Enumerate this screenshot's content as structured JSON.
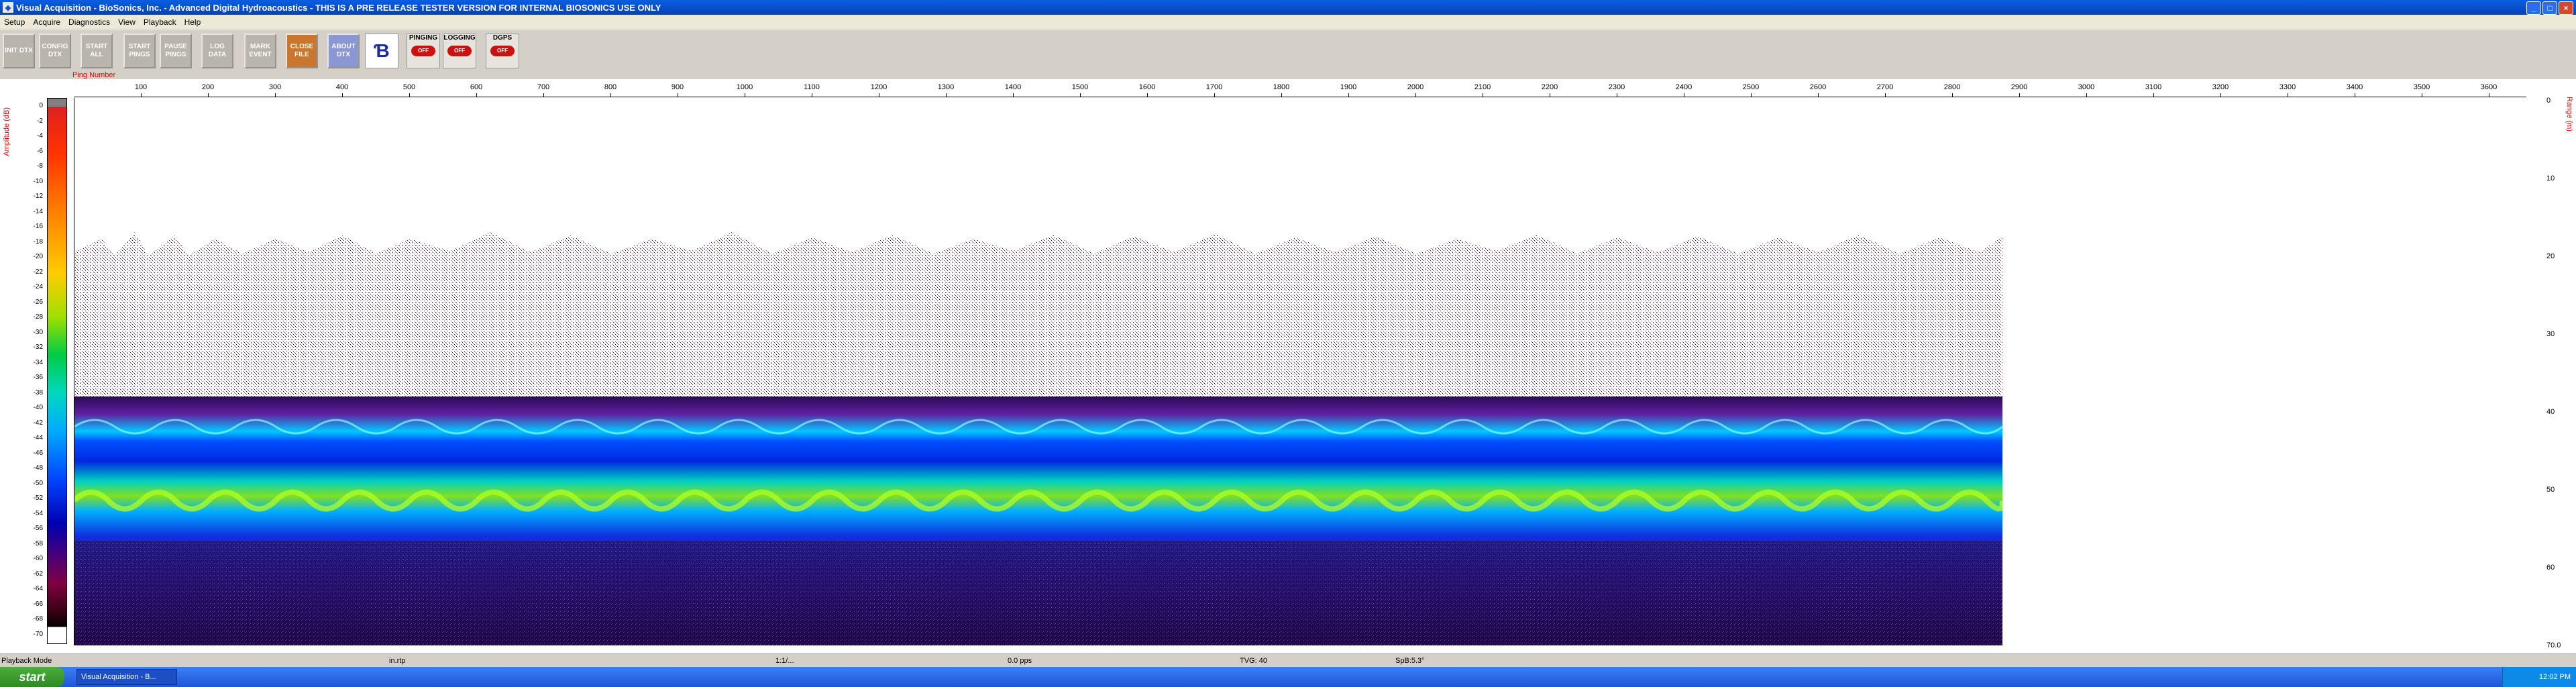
{
  "window": {
    "title": "Visual Acquisition  -  BioSonics, Inc.  -  Advanced Digital Hydroacoustics  -  THIS IS A PRE RELEASE TESTER VERSION FOR INTERNAL BIOSONICS USE ONLY",
    "controls": [
      "_",
      "□",
      "×"
    ]
  },
  "menu": [
    "Setup",
    "Acquire",
    "Diagnostics",
    "View",
    "Playback",
    "Help"
  ],
  "toolbar": {
    "buttons": [
      {
        "label": "INIT DTX",
        "style": "gray"
      },
      {
        "label": "CONFIG DTX",
        "style": "gray"
      },
      {
        "label": "START ALL",
        "style": "gray"
      },
      {
        "label": "START PINGS",
        "style": "gray"
      },
      {
        "label": "PAUSE PINGS",
        "style": "gray"
      },
      {
        "label": "LOG DATA",
        "style": "gray"
      },
      {
        "label": "MARK EVENT",
        "style": "gray"
      },
      {
        "label": "CLOSE FILE",
        "style": "orange"
      },
      {
        "label": "ABOUT DTX",
        "style": "blue"
      }
    ],
    "indicators": [
      {
        "label": "PINGING",
        "state": "OFF"
      },
      {
        "label": "LOGGING",
        "state": "OFF"
      },
      {
        "label": "DGPS",
        "state": "OFF"
      }
    ]
  },
  "plot": {
    "x_title": "Ping Number",
    "y_left_title": "Amplitude (dB)",
    "y_right_title": "Range (m)",
    "x_ticks": [
      "100",
      "200",
      "300",
      "400",
      "500",
      "600",
      "700",
      "800",
      "900",
      "1000",
      "1100",
      "1200",
      "1300",
      "1400",
      "1500",
      "1600",
      "1700",
      "1800",
      "1900",
      "2000",
      "2100",
      "2200",
      "2300",
      "2400",
      "2500",
      "2600",
      "2700",
      "2800",
      "2900",
      "3000",
      "3100",
      "3200",
      "3300",
      "3400",
      "3500",
      "3600"
    ],
    "colorbar_ticks": [
      "0",
      "-2",
      "-4",
      "-6",
      "-8",
      "-10",
      "-12",
      "-14",
      "-16",
      "-18",
      "-20",
      "-22",
      "-24",
      "-26",
      "-28",
      "-30",
      "-32",
      "-34",
      "-36",
      "-38",
      "-40",
      "-42",
      "-44",
      "-46",
      "-48",
      "-50",
      "-52",
      "-54",
      "-56",
      "-58",
      "-60",
      "-62",
      "-64",
      "-66",
      "-68",
      "-70"
    ],
    "range_ticks": [
      "0",
      "10",
      "20",
      "30",
      "40",
      "50",
      "60",
      "70.0"
    ]
  },
  "status": {
    "mode": "Playback Mode",
    "file": "in.rtp",
    "ping": "1:1/...",
    "rate": "0.0 pps",
    "tvg": "TVG: 40",
    "sp": "SpB:5.3°"
  },
  "taskbar": {
    "start": "start",
    "item": "Visual Acquisition - B...",
    "clock": "12:02 PM"
  }
}
